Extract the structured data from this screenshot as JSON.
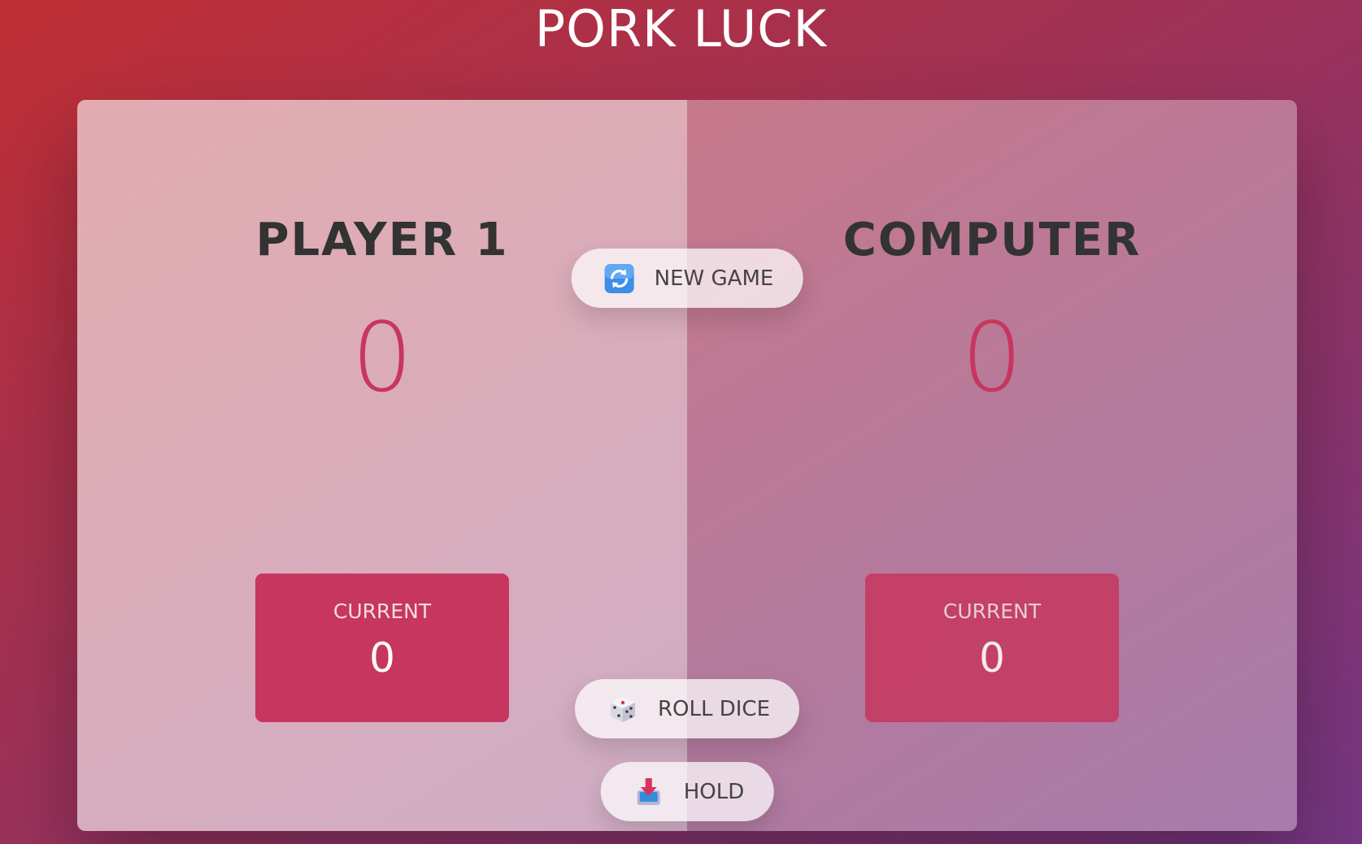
{
  "title": "PORK LUCK",
  "players": [
    {
      "name": "PLAYER 1",
      "score": "0",
      "current_label": "CURRENT",
      "current_score": "0",
      "active": true
    },
    {
      "name": "COMPUTER",
      "score": "0",
      "current_label": "CURRENT",
      "current_score": "0",
      "active": false
    }
  ],
  "buttons": {
    "new_game": {
      "label": "NEW GAME",
      "icon": "refresh-icon"
    },
    "roll_dice": {
      "label": "ROLL DICE",
      "icon": "dice-icon"
    },
    "hold": {
      "label": "HOLD",
      "icon": "inbox-tray-icon"
    }
  },
  "colors": {
    "accent": "#c7365f",
    "gradient_start": "#bf2e34",
    "gradient_end": "#753682"
  }
}
